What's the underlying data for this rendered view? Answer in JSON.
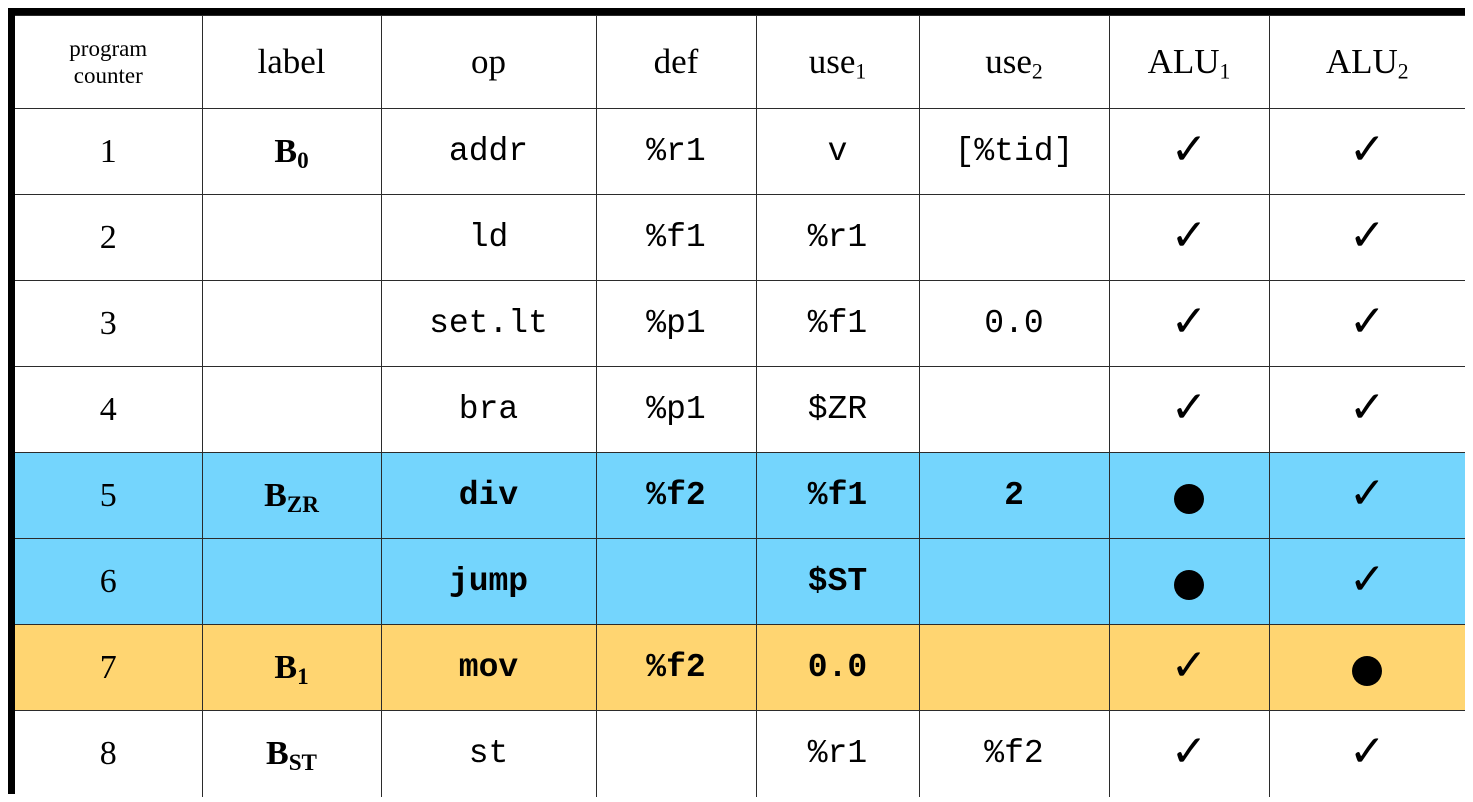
{
  "table": {
    "columns": [
      {
        "key": "pc",
        "label": "program counter",
        "label_lines": [
          "program",
          "counter"
        ]
      },
      {
        "key": "label",
        "label": "label"
      },
      {
        "key": "op",
        "label": "op"
      },
      {
        "key": "def",
        "label": "def"
      },
      {
        "key": "use1",
        "label": "use",
        "sub": "1"
      },
      {
        "key": "use2",
        "label": "use",
        "sub": "2"
      },
      {
        "key": "alu1",
        "label": "ALU",
        "sub": "1"
      },
      {
        "key": "alu2",
        "label": "ALU",
        "sub": "2"
      }
    ],
    "header": {
      "pc_line1": "program",
      "pc_line2": "counter",
      "label": "label",
      "op": "op",
      "def": "def",
      "use1": "use",
      "use1_sub": "1",
      "use2": "use",
      "use2_sub": "2",
      "alu1": "ALU",
      "alu1_sub": "1",
      "alu2": "ALU",
      "alu2_sub": "2"
    },
    "rows": [
      {
        "pc": "1",
        "label": "B",
        "label_sub": "0",
        "op": "addr",
        "def": "%r1",
        "use1": "v",
        "use2": "[%tid]",
        "alu1": "check",
        "alu2": "check",
        "highlight": "none"
      },
      {
        "pc": "2",
        "label": "",
        "label_sub": "",
        "op": "ld",
        "def": "%f1",
        "use1": "%r1",
        "use2": "",
        "alu1": "check",
        "alu2": "check",
        "highlight": "none"
      },
      {
        "pc": "3",
        "label": "",
        "label_sub": "",
        "op": "set.lt",
        "def": "%p1",
        "use1": "%f1",
        "use2": "0.0",
        "alu1": "check",
        "alu2": "check",
        "highlight": "none"
      },
      {
        "pc": "4",
        "label": "",
        "label_sub": "",
        "op": "bra",
        "def": "%p1",
        "use1": "$ZR",
        "use2": "",
        "alu1": "check",
        "alu2": "check",
        "highlight": "none"
      },
      {
        "pc": "5",
        "label": "B",
        "label_sub": "ZR",
        "op": "div",
        "def": "%f2",
        "use1": "%f1",
        "use2": "2",
        "alu1": "dot",
        "alu2": "check",
        "highlight": "blue"
      },
      {
        "pc": "6",
        "label": "",
        "label_sub": "",
        "op": "jump",
        "def": "",
        "use1": "$ST",
        "use2": "",
        "alu1": "dot",
        "alu2": "check",
        "highlight": "blue"
      },
      {
        "pc": "7",
        "label": "B",
        "label_sub": "1",
        "op": "mov",
        "def": "%f2",
        "use1": "0.0",
        "use2": "",
        "alu1": "check",
        "alu2": "dot",
        "highlight": "orange"
      },
      {
        "pc": "8",
        "label": "B",
        "label_sub": "ST",
        "op": "st",
        "def": "",
        "use1": "%r1",
        "use2": "%f2",
        "alu1": "check",
        "alu2": "check",
        "highlight": "none"
      }
    ]
  },
  "marks": {
    "check_glyph": "✓",
    "dot_name": "filled-circle"
  },
  "colors": {
    "highlight_blue": "#74d5fd",
    "highlight_orange": "#ffd571",
    "border": "#000000",
    "text": "#000000",
    "background": "#ffffff"
  }
}
